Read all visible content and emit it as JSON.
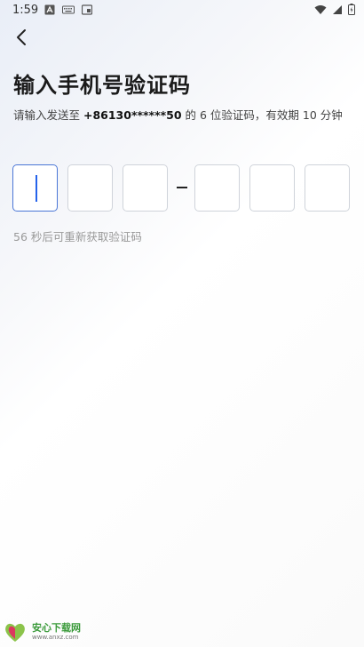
{
  "status_bar": {
    "time": "1:59"
  },
  "page": {
    "title": "输入手机号验证码",
    "description_prefix": "请输入发送至 ",
    "phone": "+86130******50",
    "description_suffix": " 的 6 位验证码，有效期 10 分钟",
    "resend_text": "56 秒后可重新获取验证码"
  },
  "code_inputs": {
    "values": [
      "",
      "",
      "",
      "",
      "",
      ""
    ],
    "active_index": 0
  },
  "watermark": {
    "brand": "安心下载网",
    "url": "www.anxz.com"
  },
  "colors": {
    "accent": "#2563eb",
    "box_border": "#cfd3da",
    "muted_text": "#999999"
  }
}
